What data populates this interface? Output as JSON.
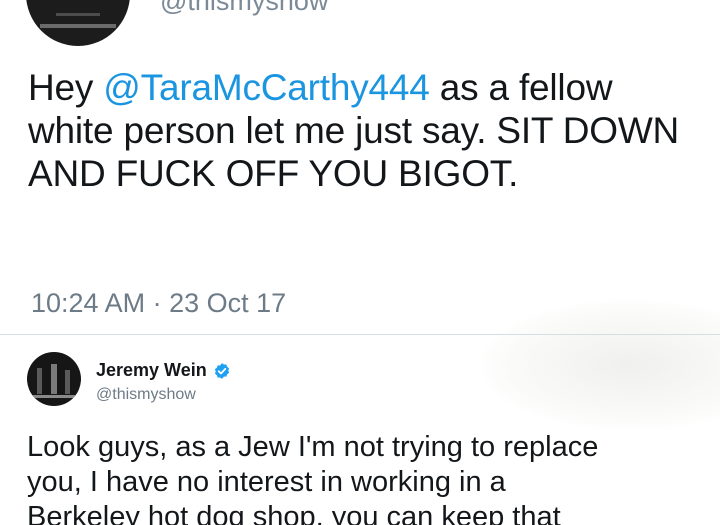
{
  "top_tweet": {
    "handle": "@thismyshow",
    "text_before": "Hey ",
    "mention": "@TaraMcCarthy444",
    "text_after": " as a fellow white person let me just say. SIT DOWN AND FUCK OFF YOU BIGOT.",
    "timestamp": "10:24 AM · 23 Oct 17"
  },
  "quoted_tweet": {
    "name": "Jeremy Wein",
    "verified_icon": "verified-badge-icon",
    "handle": "@thismyshow",
    "lines": [
      "Look guys, as a Jew I'm not trying to replace",
      "you, I have no interest in working in a",
      "Berkeley hot dog shop, you can keep that"
    ]
  },
  "colors": {
    "mention": "#1b95e0",
    "verified": "#1da1f2",
    "secondary_text": "#6d7b87"
  }
}
